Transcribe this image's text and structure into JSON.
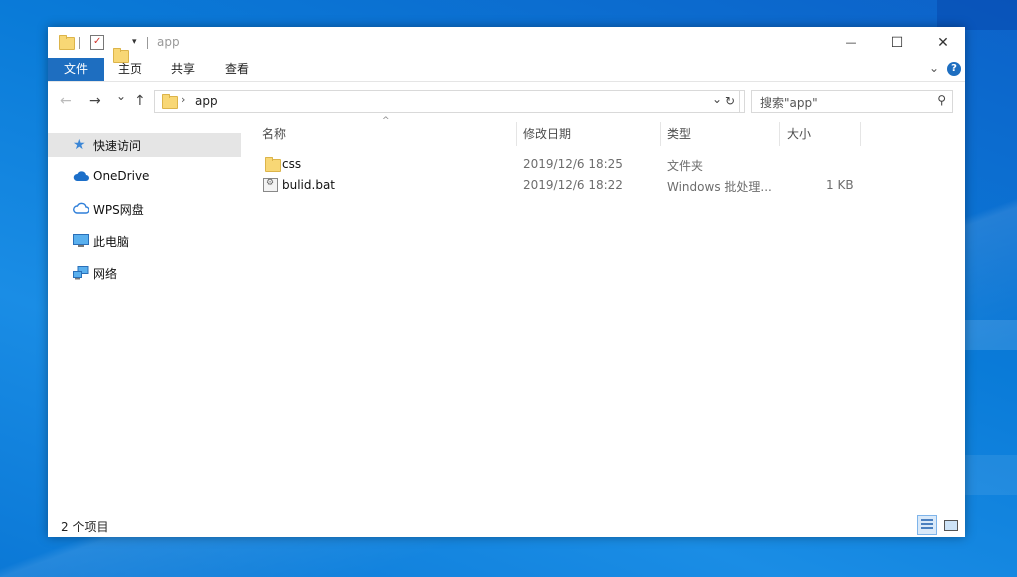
{
  "window": {
    "title": "app",
    "controls": {
      "minimize": "—",
      "maximize": "☐",
      "close": "✕"
    }
  },
  "ribbon": {
    "tabs": [
      {
        "label": "文件"
      },
      {
        "label": "主页"
      },
      {
        "label": "共享"
      },
      {
        "label": "查看"
      }
    ],
    "help": "?"
  },
  "nav": {
    "back": "←",
    "forward": "→",
    "recent": "⌄",
    "up": "↑",
    "address": "app",
    "search_placeholder": "搜索\"app\""
  },
  "sidebar": {
    "items": [
      {
        "label": "快速访问",
        "icon": "star-icon"
      },
      {
        "label": "OneDrive",
        "icon": "cloud-icon"
      },
      {
        "label": "WPS网盘",
        "icon": "cloud-outline-icon"
      },
      {
        "label": "此电脑",
        "icon": "monitor-icon"
      },
      {
        "label": "网络",
        "icon": "network-icon"
      }
    ]
  },
  "columns": {
    "name": "名称",
    "modified": "修改日期",
    "type": "类型",
    "size": "大小"
  },
  "files": [
    {
      "name": "css",
      "modified": "2019/12/6 18:25",
      "type": "文件夹",
      "size": "",
      "icon": "folder-icon"
    },
    {
      "name": "bulid.bat",
      "modified": "2019/12/6 18:22",
      "type": "Windows 批处理...",
      "size": "1 KB",
      "icon": "batch-file-icon"
    }
  ],
  "status": {
    "count": "2 个项目"
  },
  "colors": {
    "accent": "#1e6ec0",
    "selection": "#e5e5e5",
    "desktop": "#0a78d4"
  }
}
